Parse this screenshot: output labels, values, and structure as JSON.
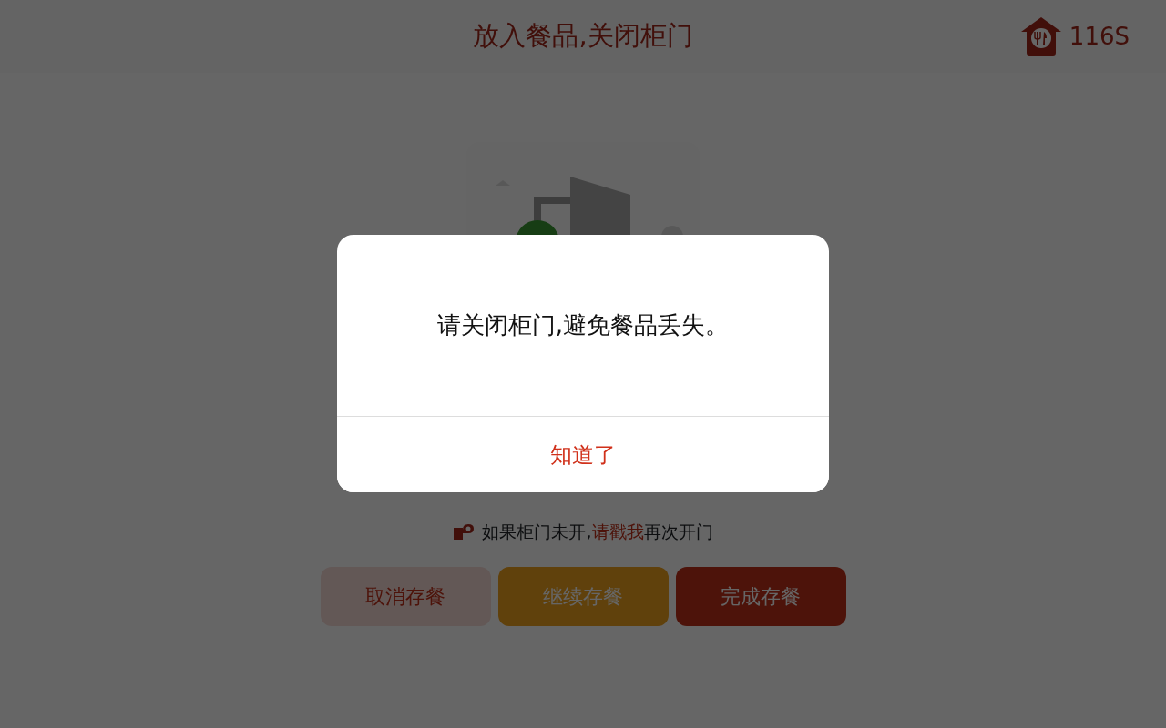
{
  "header": {
    "title": "放入餐品,关闭柜门",
    "timer": "116S"
  },
  "hint": {
    "before": "如果柜门未开,",
    "link": "请戳我",
    "after": "再次开门"
  },
  "buttons": [
    {
      "label": "取消存餐",
      "kind": "cancel"
    },
    {
      "label": "继续存餐",
      "kind": "continue"
    },
    {
      "label": "完成存餐",
      "kind": "finish"
    }
  ],
  "dialog": {
    "message": "请关闭柜门,避免餐品丢失。",
    "button": "知道了"
  }
}
